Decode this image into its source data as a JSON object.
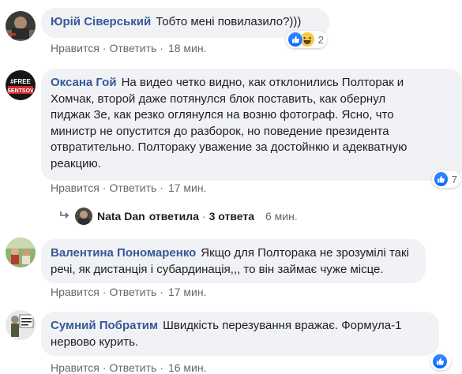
{
  "comments": [
    {
      "author": "Юрій Сіверський",
      "text": "Тобто мені повилазило?)))",
      "actions": {
        "like": "Нравится",
        "reply": "Ответить",
        "time": "18 мин."
      },
      "reactions": {
        "types": [
          "like-icon",
          "haha-icon"
        ],
        "count": "2"
      }
    },
    {
      "author": "Оксана Гой",
      "text": "На видео четко видно, как отклонились Полторак и Хомчак, второй даже потянулся блок поставить, как обернул пиджак Зе, как резко оглянулся на возню фотограф. Ясно, что министр не опустится до разборок, но поведение президента отвратительно. Полтораку уважение за достойнкю и адекватную реакцию.",
      "lines": [
        "На видео четко видно, как отклонились Полторак и",
        "Хомчак, второй даже потянулся блок поставить, как обернул",
        "пиджак Зе, как резко оглянулся на возню фотограф. Ясно, что",
        "министр не опустится до разборок, но поведение президента",
        "отвратительно. Полтораку уважение за достойнкю и адекватную",
        "реакцию."
      ],
      "avatar_text": [
        "#FREE",
        "SENTSOV"
      ],
      "actions": {
        "like": "Нравится",
        "reply": "Ответить",
        "time": "17 мин."
      },
      "reactions": {
        "types": [
          "like-icon"
        ],
        "count": "7"
      },
      "replies_summary": {
        "name": "Nata Dan",
        "verb": "ответила",
        "count_label": "3 ответа",
        "time": "6 мин."
      }
    },
    {
      "author": "Валентина Пономаренко",
      "lines": [
        "Якщо для Полторака не зрозумілі такі",
        "речі, як дистанція і субардинація,,, то він займає чуже місце."
      ],
      "actions": {
        "like": "Нравится",
        "reply": "Ответить",
        "time": "17 мин."
      }
    },
    {
      "author": "Сумний Побратим",
      "lines": [
        "Швидкість перезування вражає. Формула-1",
        "нервово курить."
      ],
      "actions": {
        "like": "Нравится",
        "reply": "Ответить",
        "time": "16 мин."
      },
      "reactions": {
        "types": [
          "like-icon"
        ],
        "count": ""
      }
    }
  ],
  "colors": {
    "author": "#385898",
    "bubble": "#f0f2f5",
    "meta": "#65676b",
    "like": "#0866ff",
    "haha": "#f7c843"
  }
}
